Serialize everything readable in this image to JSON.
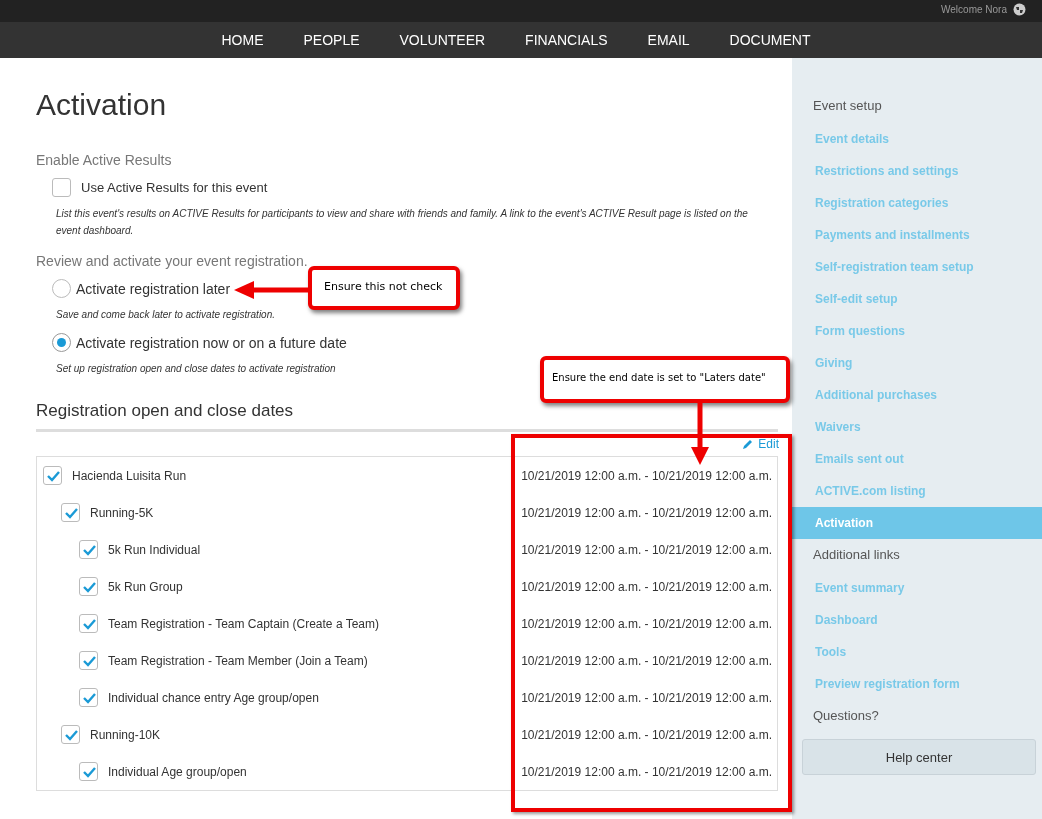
{
  "top_bar": {
    "welcome": "Welcome Nora"
  },
  "nav": [
    {
      "label": "HOME"
    },
    {
      "label": "PEOPLE"
    },
    {
      "label": "VOLUNTEER"
    },
    {
      "label": "FINANCIALS"
    },
    {
      "label": "EMAIL"
    },
    {
      "label": "DOCUMENT"
    }
  ],
  "title": "Activation",
  "results": {
    "heading": "Enable Active Results",
    "option": {
      "label": "Use Active Results for this event",
      "checked": false
    },
    "help": "List this event's results on ACTIVE Results for participants to view and share with friends and family. A link to the event's ACTIVE Result page is listed on the event dashboard."
  },
  "review": {
    "heading": "Review and activate your event registration.",
    "options": [
      {
        "label": "Activate registration later",
        "help": "Save and come back later to activate registration.",
        "selected": false
      },
      {
        "label": "Activate registration now or on a future date",
        "help": "Set up registration open and close dates to activate registration",
        "selected": true
      }
    ]
  },
  "dates": {
    "heading": "Registration open and close dates",
    "edit": "Edit",
    "tree": [
      {
        "name": "Hacienda Luisita Run",
        "dates": "10/21/2019 12:00 a.m. - 10/21/2019 12:00 a.m.",
        "checked": true,
        "children": [
          {
            "name": "Running-5K",
            "dates": "10/21/2019 12:00 a.m. - 10/21/2019 12:00 a.m.",
            "checked": true,
            "children": [
              {
                "name": "5k Run Individual",
                "dates": "10/21/2019 12:00 a.m. - 10/21/2019 12:00 a.m.",
                "checked": true
              },
              {
                "name": "5k Run Group",
                "dates": "10/21/2019 12:00 a.m. - 10/21/2019 12:00 a.m.",
                "checked": true
              },
              {
                "name": "Team Registration - Team Captain (Create a Team)",
                "dates": "10/21/2019 12:00 a.m. - 10/21/2019 12:00 a.m.",
                "checked": true
              },
              {
                "name": "Team Registration - Team Member (Join a Team)",
                "dates": "10/21/2019 12:00 a.m. - 10/21/2019 12:00 a.m.",
                "checked": true
              },
              {
                "name": "Individual chance entry Age group/open",
                "dates": "10/21/2019 12:00 a.m. - 10/21/2019 12:00 a.m.",
                "checked": true
              }
            ]
          },
          {
            "name": "Running-10K",
            "dates": "10/21/2019 12:00 a.m. - 10/21/2019 12:00 a.m.",
            "checked": true,
            "children": [
              {
                "name": "Individual Age group/open",
                "dates": "10/21/2019 12:00 a.m. - 10/21/2019 12:00 a.m.",
                "checked": true
              }
            ]
          }
        ]
      }
    ]
  },
  "sidebar": {
    "sections": [
      {
        "heading": "Event setup",
        "items": [
          {
            "label": "Event details",
            "selected": false
          },
          {
            "label": "Restrictions and settings",
            "selected": false
          },
          {
            "label": "Registration categories",
            "selected": false
          },
          {
            "label": "Payments and installments",
            "selected": false
          },
          {
            "label": "Self-registration team setup",
            "selected": false
          },
          {
            "label": "Self-edit setup",
            "selected": false
          },
          {
            "label": "Form questions",
            "selected": false
          },
          {
            "label": "Giving",
            "selected": false
          },
          {
            "label": "Additional purchases",
            "selected": false
          },
          {
            "label": "Waivers",
            "selected": false
          },
          {
            "label": "Emails sent out",
            "selected": false
          },
          {
            "label": "ACTIVE.com listing",
            "selected": false
          },
          {
            "label": "Activation",
            "selected": true
          }
        ]
      },
      {
        "heading": "Additional links",
        "items": [
          {
            "label": "Event summary",
            "selected": false
          },
          {
            "label": "Dashboard",
            "selected": false
          },
          {
            "label": "Tools",
            "selected": false
          },
          {
            "label": "Preview registration form",
            "selected": false
          }
        ]
      },
      {
        "heading": "Questions?"
      }
    ],
    "help_button": "Help center"
  },
  "annotations": [
    {
      "text": "Ensure this not check"
    },
    {
      "text": "Ensure the end date is set to \"Laters date\""
    }
  ]
}
